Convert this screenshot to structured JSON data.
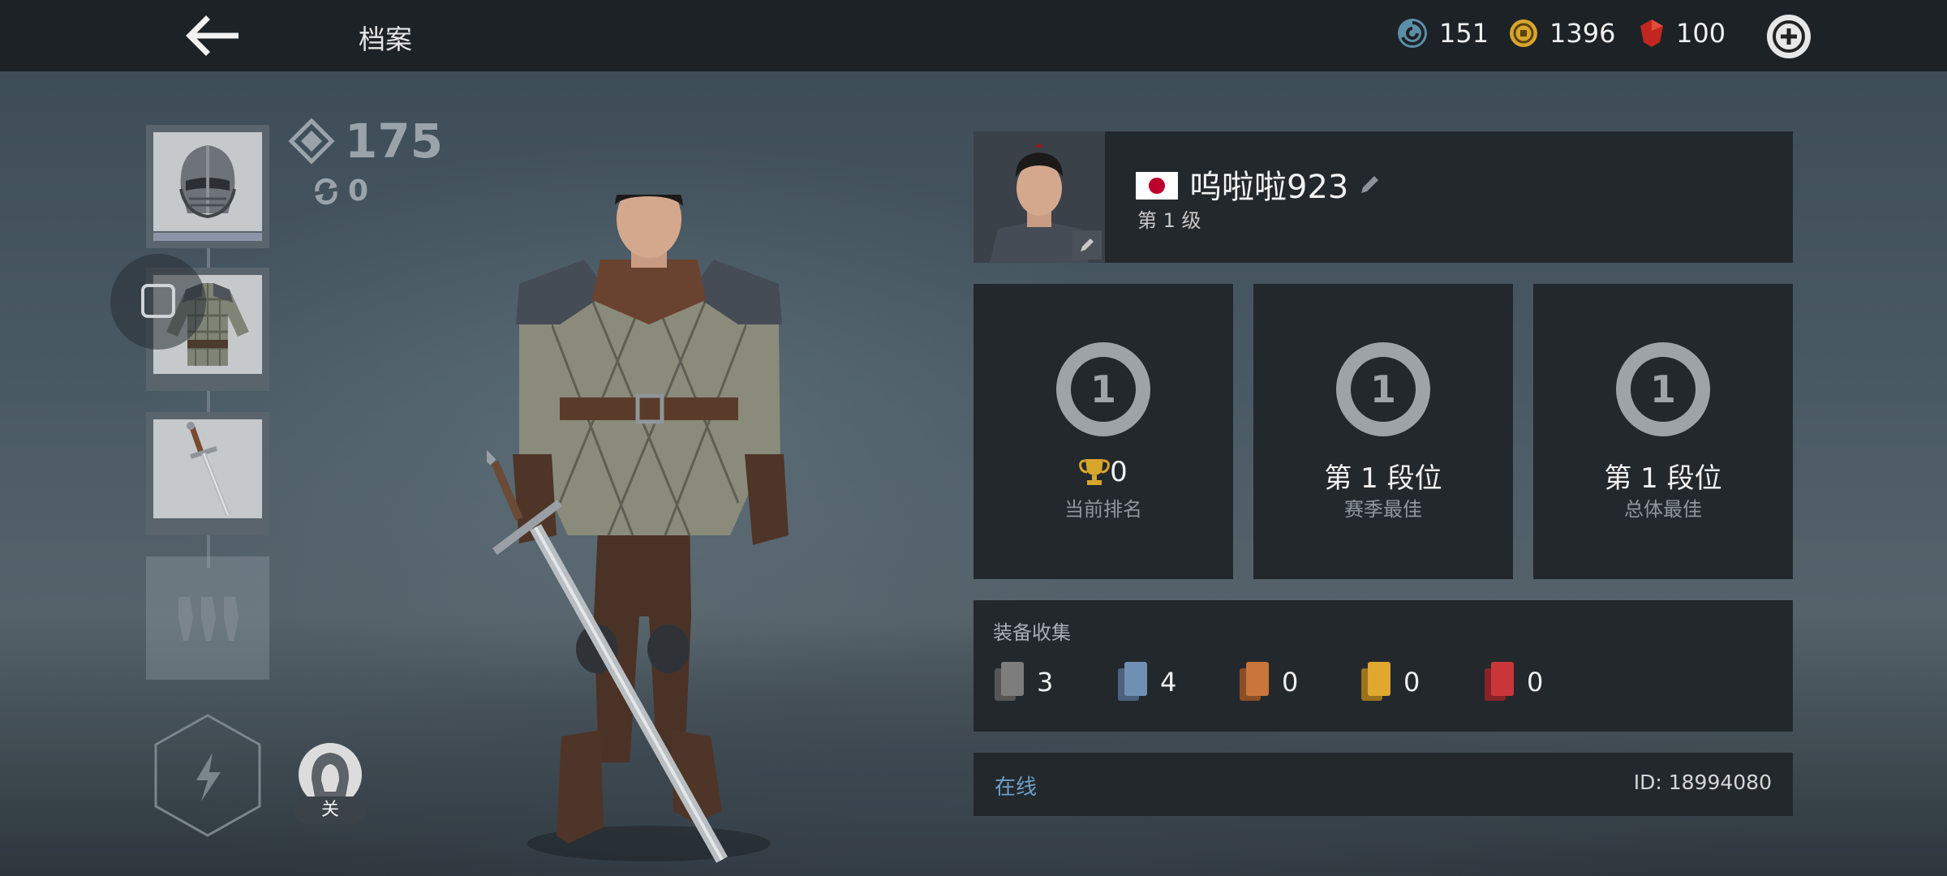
{
  "header": {
    "title": "档案",
    "back_icon": "back-arrow-icon",
    "currencies": [
      {
        "name": "steel",
        "icon": "steel-swirl-icon",
        "value": "151"
      },
      {
        "name": "coins",
        "icon": "coin-icon",
        "value": "1396"
      },
      {
        "name": "rubies",
        "icon": "ruby-icon",
        "value": "100"
      }
    ],
    "add_icon": "plus-circle-icon"
  },
  "loadout": {
    "power_score": "175",
    "reroll_count": "0",
    "slots": [
      {
        "name": "helmet",
        "icon": "helmet-icon"
      },
      {
        "name": "armor",
        "icon": "armor-icon"
      },
      {
        "name": "weapon",
        "icon": "sword-icon"
      },
      {
        "name": "ranged",
        "icon": "throwing-knives-icon",
        "locked": true
      },
      {
        "name": "ability",
        "icon": "lightning-icon",
        "locked": true
      }
    ],
    "hood_toggle_label": "关"
  },
  "profile": {
    "country_flag": "japan-flag",
    "player_name": "呜啦啦923",
    "level_text": "第 1 级"
  },
  "ranks": [
    {
      "emblem": "1",
      "value": "0",
      "label": "当前排名",
      "has_trophy": true
    },
    {
      "emblem": "1",
      "value": "第 1 段位",
      "label": "赛季最佳",
      "has_trophy": false
    },
    {
      "emblem": "1",
      "value": "第 1 段位",
      "label": "总体最佳",
      "has_trophy": false
    }
  ],
  "collection": {
    "label": "装备收集",
    "items": [
      {
        "rarity": "common",
        "color": "#7d7d7d",
        "count": "3"
      },
      {
        "rarity": "rare",
        "color": "#6f8fb5",
        "count": "4"
      },
      {
        "rarity": "epic",
        "color": "#c9763a",
        "count": "0"
      },
      {
        "rarity": "legendary",
        "color": "#e0a82e",
        "count": "0"
      },
      {
        "rarity": "mythic",
        "color": "#c9363a",
        "count": "0"
      }
    ]
  },
  "status": {
    "online_text": "在线",
    "id_text": "ID: 18994080"
  },
  "colors": {
    "topbar": "#1d2227",
    "panel": "#23282d",
    "online": "#6ea0c8"
  }
}
